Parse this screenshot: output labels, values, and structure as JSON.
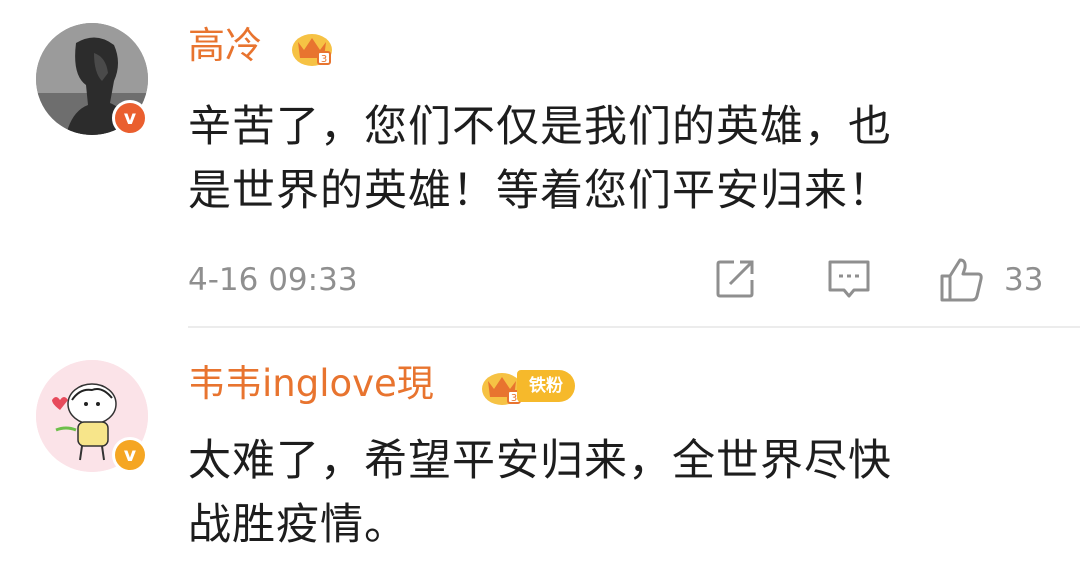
{
  "comments": [
    {
      "username": "高冷",
      "text_line1": "辛苦了，您们不仅是我们的英雄，也",
      "text_line2": "是世界的英雄！等着您们平安归来！",
      "time": "4-16 09:33",
      "likes": "33",
      "verified": true,
      "badge_color": "#ea5f2f"
    },
    {
      "username": "韦韦inglove現",
      "fan_label": "铁粉",
      "text_line1": "太难了，希望平安归来，全世界尽快",
      "text_line2": "战胜疫情。",
      "verified": true,
      "badge_color": "#f5a623"
    }
  ],
  "icons": [
    "crown-badge-icon",
    "share-icon",
    "reply-icon",
    "like-icon"
  ],
  "colors": {
    "username": "#e8742f",
    "meta": "#8f8f8f",
    "text": "#1d1d1d"
  }
}
